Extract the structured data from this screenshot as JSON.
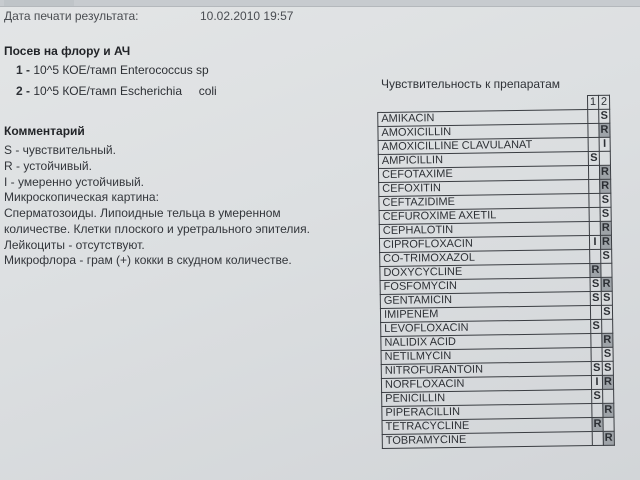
{
  "header": {
    "print_label": "Дата печати результата:",
    "print_date": "10.02.2010 19:57"
  },
  "culture": {
    "title": "Посев на флору и АЧ",
    "items": [
      {
        "num": "1 -",
        "text": "10^5 КОЕ/тамп Enterococcus sp"
      },
      {
        "num": "2 -",
        "text": "10^5 КОЕ/тамп Escherichia     coli"
      }
    ]
  },
  "comment": {
    "title": "Комментарий",
    "lines": [
      "S - чувствительный.",
      "R - устойчивый.",
      "I - умеренно устойчивый.",
      "Микроскопическая картина:",
      "Сперматозоиды. Липоидные тельца в умеренном",
      "количестве. Клетки плоского и уретрального эпителия.",
      "Лейкоциты - отсутствуют.",
      "Микрофлора - грам (+) кокки в скудном количестве."
    ]
  },
  "sensitivity": {
    "title": "Чувствительность к препаратам",
    "col_headers": [
      "1",
      "2"
    ],
    "rows": [
      {
        "name": "AMIKACIN",
        "c1": "",
        "c2": "S"
      },
      {
        "name": "AMOXICILLIN",
        "c1": "",
        "c2": "R"
      },
      {
        "name": "AMOXICILLINE CLAVULANAT",
        "c1": "",
        "c2": "I"
      },
      {
        "name": "AMPICILLIN",
        "c1": "S",
        "c2": ""
      },
      {
        "name": "CEFOTAXIME",
        "c1": "",
        "c2": "R"
      },
      {
        "name": "CEFOXITIN",
        "c1": "",
        "c2": "R"
      },
      {
        "name": "CEFTAZIDIME",
        "c1": "",
        "c2": "S"
      },
      {
        "name": "CEFUROXIME AXETIL",
        "c1": "",
        "c2": "S"
      },
      {
        "name": "CEPHALOTIN",
        "c1": "",
        "c2": "R"
      },
      {
        "name": "CIPROFLOXACIN",
        "c1": "I",
        "c2": "R"
      },
      {
        "name": "CO-TRIMOXAZOL",
        "c1": "",
        "c2": "S"
      },
      {
        "name": "DOXYCYCLINE",
        "c1": "R",
        "c2": ""
      },
      {
        "name": "FOSFOMYCIN",
        "c1": "S",
        "c2": "R"
      },
      {
        "name": "GENTAMICIN",
        "c1": "S",
        "c2": "S"
      },
      {
        "name": "IMIPENEM",
        "c1": "",
        "c2": "S"
      },
      {
        "name": "LEVOFLOXACIN",
        "c1": "S",
        "c2": ""
      },
      {
        "name": "NALIDIX ACID",
        "c1": "",
        "c2": "R"
      },
      {
        "name": "NETILMYCIN",
        "c1": "",
        "c2": "S"
      },
      {
        "name": "NITROFURANTOIN",
        "c1": "S",
        "c2": "S"
      },
      {
        "name": "NORFLOXACIN",
        "c1": "I",
        "c2": "R"
      },
      {
        "name": "PENICILLIN",
        "c1": "S",
        "c2": ""
      },
      {
        "name": "PIPERACILLIN",
        "c1": "",
        "c2": "R"
      },
      {
        "name": "TETRACYCLINE",
        "c1": "R",
        "c2": ""
      },
      {
        "name": "TOBRAMYCINE",
        "c1": "",
        "c2": "R"
      }
    ]
  }
}
